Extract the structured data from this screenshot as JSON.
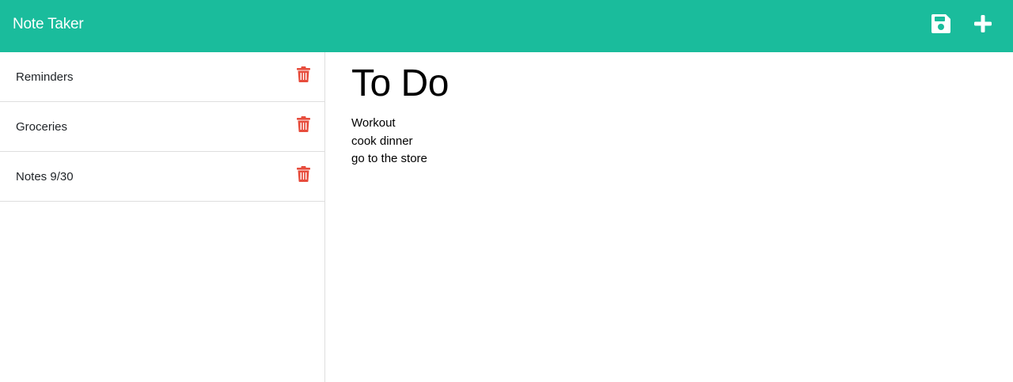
{
  "app": {
    "title": "Note Taker"
  },
  "toolbar": {
    "save_icon": "save-icon",
    "new_icon": "plus-icon"
  },
  "colors": {
    "navbar": "#1abc9c",
    "trash": "#e74c3c"
  },
  "sidebar": {
    "notes": [
      {
        "title": "Reminders"
      },
      {
        "title": "Groceries"
      },
      {
        "title": "Notes 9/30"
      }
    ]
  },
  "active_note": {
    "title": "To Do",
    "text": "Workout\ncook dinner\ngo to the store"
  }
}
